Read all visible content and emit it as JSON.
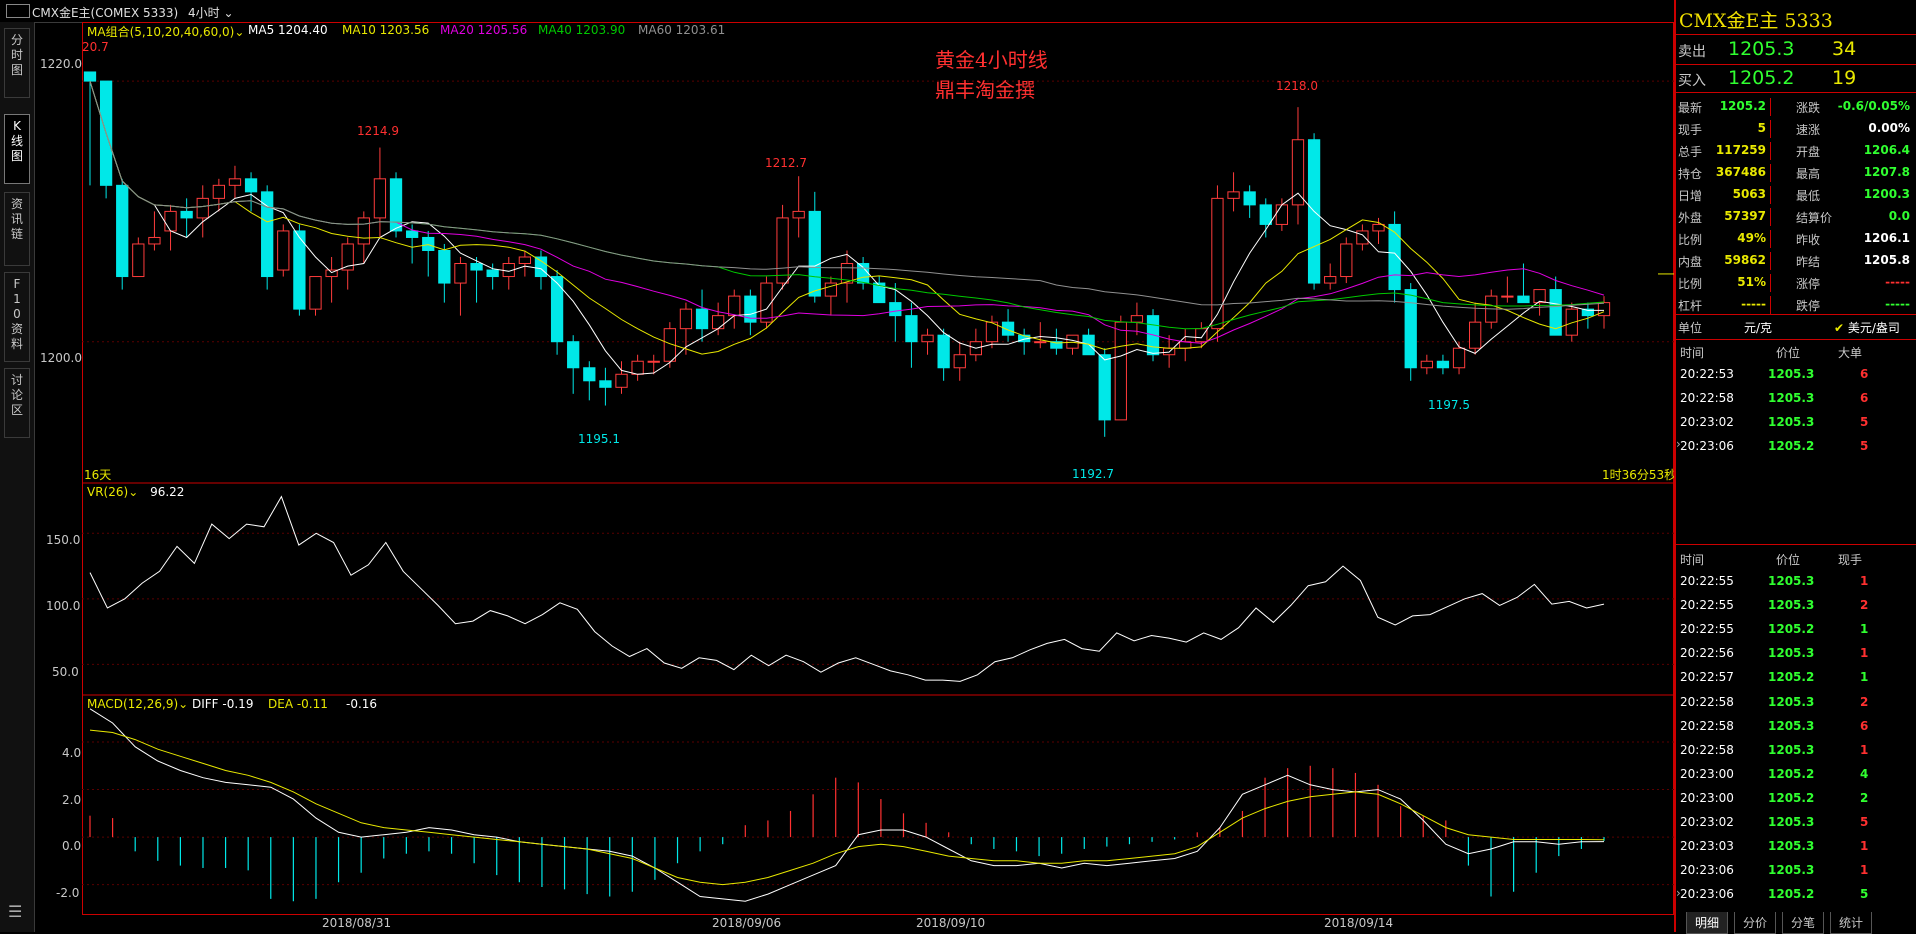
{
  "window": {
    "title": "CMX金E主(COMEX 5333)",
    "period": "4小时"
  },
  "side_tabs": [
    {
      "label": "分时图"
    },
    {
      "label": "K线图"
    },
    {
      "label": "资讯链"
    },
    {
      "label": "F10资料"
    },
    {
      "label": "讨论区"
    }
  ],
  "main_chart": {
    "ma_label": "MA组合(5,10,20,40,60,0)",
    "ma5": "MA5 1204.40",
    "ma10": "MA10 1203.56",
    "ma20": "MA20 1205.56",
    "ma40": "MA40 1203.90",
    "ma60": "MA60 1203.61",
    "annotation_line1": "黄金4小时线",
    "annotation_line2": "鼎丰淘金撰",
    "y_ticks": [
      "1220.0",
      "1200.0"
    ],
    "high_labels": [
      "20.7",
      "1214.9",
      "1212.7",
      "1218.0"
    ],
    "low_labels": [
      "1195.1",
      "1192.7",
      "1197.5"
    ],
    "days_label": "16天",
    "countdown": "1时36分53秒",
    "colors": {
      "up": "#ff3c3c",
      "down": "#00e8e8",
      "ma5": "#ffffff",
      "ma10": "#e8e800",
      "ma20": "#e000e0",
      "ma40": "#00c800",
      "ma60": "#909090"
    }
  },
  "vr_chart": {
    "label": "VR(26)",
    "value": "96.22",
    "y_ticks": [
      "150.0",
      "100.0",
      "50.0"
    ]
  },
  "macd_chart": {
    "label": "MACD(12,26,9)",
    "diff": "DIFF -0.19",
    "dea": "DEA -0.11",
    "macd": "-0.16",
    "y_ticks": [
      "4.0",
      "2.0",
      "0.0",
      "-2.0"
    ]
  },
  "x_dates": [
    "2018/08/31",
    "2018/09/06",
    "2018/09/10",
    "2018/09/14"
  ],
  "chart_data": {
    "type": "candlestick",
    "series": [
      {
        "name": "K",
        "ohlc": [
          [
            1220.7,
            1220.7,
            1212,
            1220
          ],
          [
            1220,
            1220,
            1211,
            1212
          ],
          [
            1212,
            1212.5,
            1204,
            1205
          ],
          [
            1205,
            1208,
            1205,
            1207.5
          ],
          [
            1207.5,
            1210,
            1207,
            1208
          ],
          [
            1208.5,
            1210.5,
            1207,
            1210
          ],
          [
            1210,
            1211,
            1208,
            1209.5
          ],
          [
            1209.5,
            1212,
            1208,
            1211
          ],
          [
            1211,
            1212.5,
            1210,
            1212
          ],
          [
            1212,
            1213.5,
            1211,
            1212.5
          ],
          [
            1212.5,
            1213,
            1210,
            1211.5
          ],
          [
            1211.5,
            1212,
            1204,
            1205
          ],
          [
            1205.5,
            1209,
            1205,
            1208.5
          ],
          [
            1208.5,
            1209,
            1202,
            1202.5
          ],
          [
            1202.5,
            1205,
            1202,
            1205
          ],
          [
            1205,
            1206.5,
            1203,
            1205.5
          ],
          [
            1205.5,
            1208,
            1204,
            1207.5
          ],
          [
            1207.5,
            1210,
            1206,
            1209.5
          ],
          [
            1209.5,
            1214.9,
            1208,
            1212.5
          ],
          [
            1212.5,
            1213,
            1208,
            1208.5
          ],
          [
            1208.5,
            1209,
            1206,
            1208
          ],
          [
            1208,
            1208.5,
            1205,
            1207
          ],
          [
            1207,
            1207.5,
            1203,
            1204.5
          ],
          [
            1204.5,
            1206.5,
            1202,
            1206
          ],
          [
            1206,
            1206.5,
            1203,
            1205.5
          ],
          [
            1205.5,
            1206,
            1204,
            1205
          ],
          [
            1205,
            1206.5,
            1204,
            1206
          ],
          [
            1206,
            1207,
            1205,
            1206.5
          ],
          [
            1206.5,
            1207,
            1204,
            1205
          ],
          [
            1205,
            1205.5,
            1199,
            1200
          ],
          [
            1200,
            1200.5,
            1196,
            1198
          ],
          [
            1198,
            1198.5,
            1195.5,
            1197
          ],
          [
            1197,
            1198,
            1195.1,
            1196.5
          ],
          [
            1196.5,
            1198.5,
            1196,
            1197.5
          ],
          [
            1197.5,
            1199,
            1197,
            1198.5
          ],
          [
            1198.5,
            1199,
            1197.5,
            1198.5
          ],
          [
            1198.5,
            1201.5,
            1198,
            1201
          ],
          [
            1201,
            1203,
            1199,
            1202.5
          ],
          [
            1202.5,
            1204,
            1200,
            1201
          ],
          [
            1201,
            1203,
            1200.5,
            1202
          ],
          [
            1202,
            1204,
            1201,
            1203.5
          ],
          [
            1203.5,
            1204,
            1200.5,
            1201.5
          ],
          [
            1201.5,
            1205,
            1201,
            1204.5
          ],
          [
            1204.5,
            1210.5,
            1204,
            1209.5
          ],
          [
            1209.5,
            1212.7,
            1208,
            1210
          ],
          [
            1210,
            1211.5,
            1203,
            1203.5
          ],
          [
            1203.5,
            1205,
            1202,
            1204.5
          ],
          [
            1204.5,
            1207,
            1203,
            1206
          ],
          [
            1206,
            1206.5,
            1204,
            1204.5
          ],
          [
            1204.5,
            1205,
            1203,
            1203
          ],
          [
            1203,
            1204.5,
            1200,
            1202
          ],
          [
            1202,
            1203,
            1198,
            1200
          ],
          [
            1200,
            1201,
            1199,
            1200.5
          ],
          [
            1200.5,
            1201,
            1197,
            1198
          ],
          [
            1198,
            1200,
            1197,
            1199
          ],
          [
            1199,
            1201,
            1198.5,
            1200
          ],
          [
            1200,
            1202,
            1199.5,
            1201.5
          ],
          [
            1201.5,
            1202.5,
            1200,
            1200.5
          ],
          [
            1200.5,
            1201,
            1199,
            1200
          ],
          [
            1200,
            1201.5,
            1199.5,
            1200
          ],
          [
            1200,
            1201,
            1199,
            1199.5
          ],
          [
            1199.5,
            1200.5,
            1199,
            1200.5
          ],
          [
            1200.5,
            1201,
            1199,
            1199
          ],
          [
            1199,
            1199.5,
            1192.7,
            1194
          ],
          [
            1194,
            1202,
            1194,
            1201.5
          ],
          [
            1201.5,
            1203,
            1200.5,
            1202
          ],
          [
            1202,
            1202.5,
            1198.5,
            1199
          ],
          [
            1199,
            1200.5,
            1198,
            1199.5
          ],
          [
            1199.5,
            1201,
            1198.5,
            1200
          ],
          [
            1200,
            1201.5,
            1199.5,
            1201
          ],
          [
            1201,
            1212,
            1200,
            1211
          ],
          [
            1211,
            1213,
            1210,
            1211.5
          ],
          [
            1211.5,
            1212,
            1209.5,
            1210.5
          ],
          [
            1210.5,
            1211,
            1208,
            1209
          ],
          [
            1209,
            1211,
            1208.5,
            1210.5
          ],
          [
            1210.5,
            1218,
            1209,
            1215.5
          ],
          [
            1215.5,
            1216,
            1204,
            1204.5
          ],
          [
            1204.5,
            1206,
            1204,
            1205
          ],
          [
            1205,
            1208,
            1204.5,
            1207.5
          ],
          [
            1207.5,
            1209,
            1207,
            1208.5
          ],
          [
            1208.5,
            1209.5,
            1207.5,
            1209
          ],
          [
            1209,
            1210,
            1203,
            1204
          ],
          [
            1204,
            1204.5,
            1197,
            1198
          ],
          [
            1198,
            1199,
            1197.5,
            1198.5
          ],
          [
            1198.5,
            1199,
            1197.5,
            1198
          ],
          [
            1198,
            1200,
            1197.5,
            1199.5
          ],
          [
            1199.5,
            1203,
            1199,
            1201.5
          ],
          [
            1201.5,
            1204,
            1201,
            1203.5
          ],
          [
            1203.5,
            1205,
            1203,
            1203.5
          ],
          [
            1203.5,
            1206,
            1203,
            1203
          ],
          [
            1203,
            1204,
            1202,
            1204
          ],
          [
            1204,
            1205,
            1201.5,
            1200.5
          ],
          [
            1200.5,
            1203,
            1200,
            1202.5
          ],
          [
            1202.5,
            1203,
            1201,
            1202
          ],
          [
            1202,
            1203.5,
            1201,
            1203
          ]
        ]
      },
      {
        "name": "VR(26)",
        "values": [
          120,
          93,
          100,
          112,
          121,
          140,
          127,
          157,
          146,
          157,
          155,
          178,
          141,
          150,
          143,
          118,
          126,
          143,
          121,
          108,
          95,
          81,
          83,
          91,
          87,
          81,
          88,
          97,
          92,
          75,
          64,
          56,
          62,
          51,
          47,
          55,
          53,
          46,
          57,
          49,
          57,
          52,
          44,
          51,
          55,
          50,
          45,
          42,
          38,
          38,
          37,
          42,
          52,
          55,
          61,
          66,
          69,
          62,
          60,
          74,
          68,
          72,
          70,
          67,
          74,
          69,
          78,
          93,
          82,
          95,
          110,
          113,
          125,
          114,
          86,
          80,
          87,
          88,
          94,
          100,
          104,
          95,
          101,
          111,
          96,
          98,
          93,
          96
        ]
      },
      {
        "name": "DIFF",
        "values": [
          5.4,
          4.8,
          3.8,
          3.2,
          2.8,
          2.5,
          2.3,
          2.2,
          2.1,
          1.6,
          0.8,
          0.2,
          0.0,
          0.1,
          0.2,
          0.4,
          0.3,
          0.1,
          0.0,
          -0.2,
          -0.3,
          -0.4,
          -0.5,
          -0.6,
          -0.8,
          -1.3,
          -1.9,
          -2.5,
          -2.6,
          -2.7,
          -2.4,
          -2.0,
          -1.6,
          -1.2,
          0.1,
          0.3,
          0.3,
          0.0,
          -0.5,
          -1.0,
          -1.2,
          -1.2,
          -1.1,
          -1.3,
          -1.1,
          -1.2,
          -1.1,
          -1.0,
          -0.9,
          -0.6,
          0.4,
          1.8,
          2.2,
          2.6,
          2.2,
          2.0,
          1.9,
          2.0,
          1.6,
          0.7,
          -0.3,
          -0.7,
          -0.5,
          -0.2,
          -0.2,
          -0.3,
          -0.2,
          -0.19
        ]
      },
      {
        "name": "DEA",
        "values": [
          4.5,
          4.4,
          4.1,
          3.7,
          3.4,
          3.1,
          2.8,
          2.6,
          2.3,
          1.9,
          1.4,
          1.0,
          0.6,
          0.4,
          0.3,
          0.2,
          0.1,
          0.0,
          -0.1,
          -0.2,
          -0.3,
          -0.4,
          -0.5,
          -0.7,
          -0.9,
          -1.3,
          -1.7,
          -1.9,
          -2.0,
          -1.9,
          -1.7,
          -1.4,
          -1.1,
          -0.7,
          -0.4,
          -0.3,
          -0.4,
          -0.6,
          -0.8,
          -0.9,
          -1.0,
          -1.0,
          -1.1,
          -1.1,
          -1.0,
          -1.0,
          -0.9,
          -0.8,
          -0.7,
          -0.4,
          0.2,
          0.8,
          1.2,
          1.5,
          1.7,
          1.8,
          1.9,
          1.8,
          1.4,
          0.9,
          0.4,
          0.1,
          0.0,
          -0.1,
          -0.1,
          -0.1,
          -0.1,
          -0.11
        ]
      },
      {
        "name": "MACD",
        "values": [
          0.9,
          0.8,
          -0.6,
          -1.0,
          -1.2,
          -1.3,
          -1.3,
          -1.4,
          -2.6,
          -2.7,
          -2.6,
          -1.9,
          -1.5,
          -0.9,
          -0.7,
          -0.6,
          -0.7,
          -1.1,
          -1.6,
          -1.9,
          -2.1,
          -2.2,
          -2.4,
          -2.5,
          -2.3,
          -1.8,
          -1.1,
          -0.6,
          -0.3,
          0.5,
          0.7,
          1.1,
          1.8,
          2.5,
          2.3,
          1.6,
          1.0,
          0.6,
          0.2,
          -0.3,
          -0.5,
          -0.6,
          -0.8,
          -0.7,
          -0.5,
          -0.4,
          -0.3,
          -0.2,
          -0.1,
          0.2,
          0.4,
          1.1,
          2.5,
          2.9,
          3.0,
          2.9,
          2.7,
          2.2,
          1.3,
          0.9,
          0.7,
          -1.2,
          -2.5,
          -2.3,
          -1.5,
          -0.8,
          -0.5,
          -0.16
        ]
      }
    ],
    "ylim_main": [
      1190,
      1223
    ],
    "ylim_vr": [
      35,
      180
    ],
    "ylim_macd": [
      -2.9,
      5.6
    ]
  },
  "quote_panel": {
    "name": "CMX金E主  5333",
    "sell_label": "卖出",
    "sell_price": "1205.3",
    "sell_vol": "34",
    "buy_label": "买入",
    "buy_price": "1205.2",
    "buy_vol": "19",
    "rows": [
      {
        "l1": "最新",
        "v1": "1205.2",
        "c1": "#30ff30",
        "l2": "涨跌",
        "v2": "-0.6/0.05%",
        "c2": "#30ff30"
      },
      {
        "l1": "现手",
        "v1": "5",
        "c1": "#e8e800",
        "l2": "速涨",
        "v2": "0.00%",
        "c2": "#ffffff"
      },
      {
        "l1": "总手",
        "v1": "117259",
        "c1": "#e8e800",
        "l2": "开盘",
        "v2": "1206.4",
        "c2": "#30ff30"
      },
      {
        "l1": "持仓",
        "v1": "367486",
        "c1": "#e8e800",
        "l2": "最高",
        "v2": "1207.8",
        "c2": "#30ff30"
      },
      {
        "l1": "日增",
        "v1": "5063",
        "c1": "#e8e800",
        "l2": "最低",
        "v2": "1200.3",
        "c2": "#30ff30"
      },
      {
        "l1": "外盘",
        "v1": "57397",
        "c1": "#e8e800",
        "l2": "结算价",
        "v2": "0.0",
        "c2": "#30ff30"
      },
      {
        "l1": "比例",
        "v1": "49%",
        "c1": "#e8e800",
        "l2": "昨收",
        "v2": "1206.1",
        "c2": "#ffffff"
      },
      {
        "l1": "内盘",
        "v1": "59862",
        "c1": "#e8e800",
        "l2": "昨结",
        "v2": "1205.8",
        "c2": "#ffffff"
      },
      {
        "l1": "比例",
        "v1": "51%",
        "c1": "#e8e800",
        "l2": "涨停",
        "v2": "-----",
        "c2": "#ff3030"
      },
      {
        "l1": "杠杆",
        "v1": "-----",
        "c1": "#e8e800",
        "l2": "跌停",
        "v2": "-----",
        "c2": "#30ff30"
      }
    ],
    "unit_label": "单位",
    "unit_cny": "元/克",
    "unit_usd": "美元/盎司",
    "big_header": {
      "time": "时间",
      "price": "价位",
      "qty": "大单"
    },
    "big_orders": [
      {
        "time": "20:22:53",
        "price": "1205.3",
        "qty": "6"
      },
      {
        "time": "20:22:58",
        "price": "1205.3",
        "qty": "6"
      },
      {
        "time": "20:23:02",
        "price": "1205.3",
        "qty": "5"
      },
      {
        "time": "20:23:06",
        "price": "1205.2",
        "qty": "5"
      }
    ],
    "tick_header": {
      "time": "时间",
      "price": "价位",
      "qty": "现手"
    },
    "ticks": [
      {
        "time": "20:22:55",
        "price": "1205.3",
        "qty": "1",
        "qc": "#ff3030"
      },
      {
        "time": "20:22:55",
        "price": "1205.3",
        "qty": "2",
        "qc": "#ff3030"
      },
      {
        "time": "20:22:55",
        "price": "1205.2",
        "qty": "1",
        "qc": "#30ff30"
      },
      {
        "time": "20:22:56",
        "price": "1205.3",
        "qty": "1",
        "qc": "#ff3030"
      },
      {
        "time": "20:22:57",
        "price": "1205.2",
        "qty": "1",
        "qc": "#30ff30"
      },
      {
        "time": "20:22:58",
        "price": "1205.3",
        "qty": "2",
        "qc": "#ff3030"
      },
      {
        "time": "20:22:58",
        "price": "1205.3",
        "qty": "6",
        "qc": "#ff3030"
      },
      {
        "time": "20:22:58",
        "price": "1205.3",
        "qty": "1",
        "qc": "#ff3030"
      },
      {
        "time": "20:23:00",
        "price": "1205.2",
        "qty": "4",
        "qc": "#30ff30"
      },
      {
        "time": "20:23:00",
        "price": "1205.2",
        "qty": "2",
        "qc": "#30ff30"
      },
      {
        "time": "20:23:02",
        "price": "1205.3",
        "qty": "5",
        "qc": "#ff3030"
      },
      {
        "time": "20:23:03",
        "price": "1205.3",
        "qty": "1",
        "qc": "#ff3030"
      },
      {
        "time": "20:23:06",
        "price": "1205.3",
        "qty": "1",
        "qc": "#ff3030"
      },
      {
        "time": "20:23:06",
        "price": "1205.2",
        "qty": "5",
        "qc": "#30ff30"
      }
    ],
    "bottom_tabs": [
      "明细",
      "分价",
      "分笔",
      "统计"
    ]
  }
}
